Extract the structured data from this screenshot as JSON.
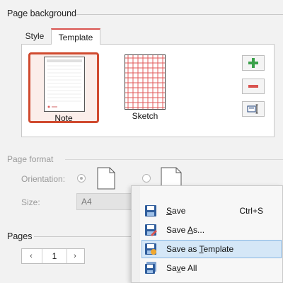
{
  "page_background": {
    "title": "Page background",
    "tabs": [
      {
        "label": "Style",
        "active": false
      },
      {
        "label": "Template",
        "active": true
      }
    ],
    "templates": [
      {
        "name": "Note",
        "selected": true
      },
      {
        "name": "Sketch",
        "selected": false
      }
    ],
    "side_buttons": [
      {
        "icon": "plus-icon",
        "color": "#3aa14a"
      },
      {
        "icon": "minus-icon",
        "color": "#d9534f"
      },
      {
        "icon": "edit-icon",
        "color": "#3d5a8a"
      }
    ]
  },
  "page_format": {
    "title": "Page format",
    "orientation_label": "Orientation:",
    "orientation_options": [
      {
        "name": "portrait",
        "checked": true
      },
      {
        "name": "landscape",
        "checked": false
      }
    ],
    "size_label": "Size:",
    "size_value": "A4"
  },
  "pages": {
    "title": "Pages",
    "value": "1",
    "prev_label": "‹",
    "next_label": "›"
  },
  "context_menu": {
    "items": [
      {
        "pre": "",
        "ul": "S",
        "post": "ave",
        "shortcut": "Ctrl+S",
        "icon": "save-icon",
        "highlighted": false
      },
      {
        "pre": "Save ",
        "ul": "A",
        "post": "s...",
        "shortcut": "",
        "icon": "save-as-icon",
        "highlighted": false
      },
      {
        "pre": "Save as ",
        "ul": "T",
        "post": "emplate",
        "shortcut": "",
        "icon": "save-template-icon",
        "highlighted": true
      },
      {
        "pre": "Sa",
        "ul": "v",
        "post": "e All",
        "shortcut": "",
        "icon": "save-all-icon",
        "highlighted": false
      }
    ]
  },
  "colors": {
    "accent": "#d04a2f",
    "highlight": "#d5e7f7"
  }
}
